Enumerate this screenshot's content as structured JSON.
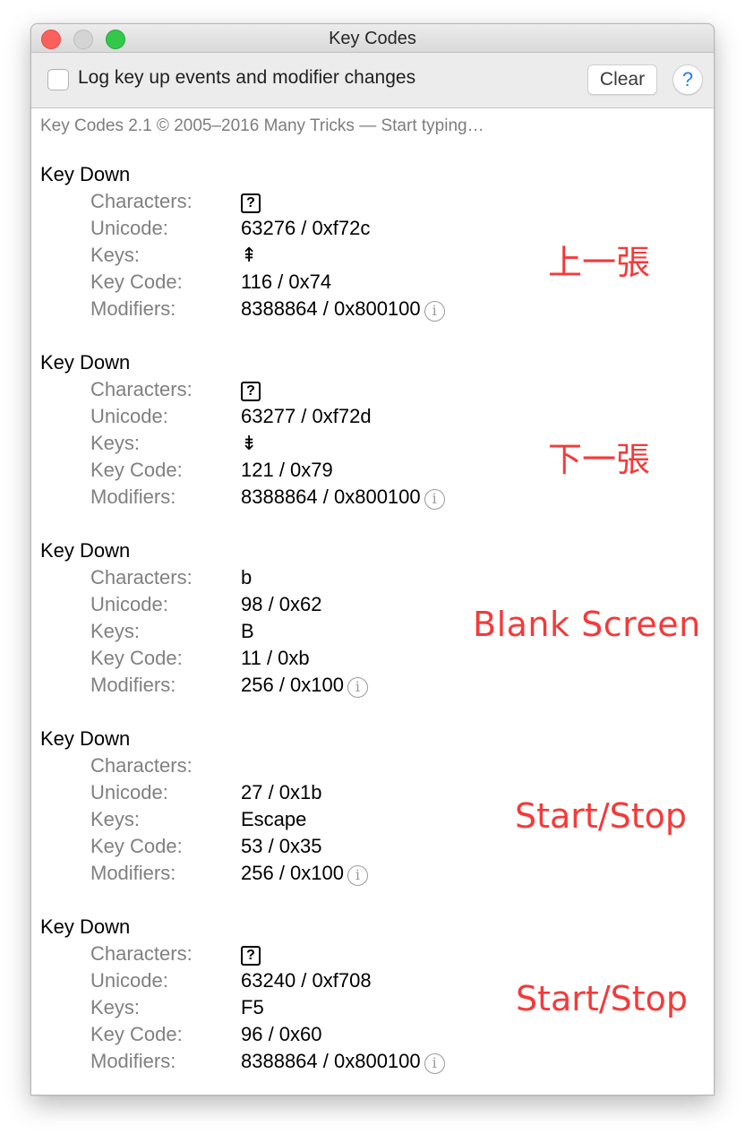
{
  "window": {
    "title": "Key Codes"
  },
  "toolbar": {
    "checkbox_label": "Log key up events and modifier changes",
    "checkbox_checked": false,
    "clear_label": "Clear",
    "help_label": "?"
  },
  "banner": "Key Codes 2.1 © 2005–2016 Many Tricks — Start typing…",
  "field_labels": {
    "characters": "Characters:",
    "unicode": "Unicode:",
    "keys": "Keys:",
    "key_code": "Key Code:",
    "modifiers": "Modifiers:"
  },
  "events": [
    {
      "title": "Key Down",
      "characters": "?",
      "characters_is_placeholder_box": true,
      "unicode": "63276 / 0xf72c",
      "keys": "⇞",
      "key_code": "116 / 0x74",
      "modifiers": "8388864 / 0x800100",
      "annotation": "上一張"
    },
    {
      "title": "Key Down",
      "characters": "?",
      "characters_is_placeholder_box": true,
      "unicode": "63277 / 0xf72d",
      "keys": "⇟",
      "key_code": "121 / 0x79",
      "modifiers": "8388864 / 0x800100",
      "annotation": "下一張"
    },
    {
      "title": "Key Down",
      "characters": "b",
      "characters_is_placeholder_box": false,
      "unicode": "98 / 0x62",
      "keys": "B",
      "key_code": "11 / 0xb",
      "modifiers": "256 / 0x100",
      "annotation": "Blank Screen"
    },
    {
      "title": "Key Down",
      "characters": "",
      "characters_is_placeholder_box": false,
      "unicode": "27 / 0x1b",
      "keys": "Escape",
      "key_code": "53 / 0x35",
      "modifiers": "256 / 0x100",
      "annotation": "Start/Stop"
    },
    {
      "title": "Key Down",
      "characters": "?",
      "characters_is_placeholder_box": true,
      "unicode": "63240 / 0xf708",
      "keys": "F5",
      "key_code": "96 / 0x60",
      "modifiers": "8388864 / 0x800100",
      "annotation": "Start/Stop"
    }
  ],
  "info_icon_glyph": "i",
  "colors": {
    "annotation": "#f43a3a",
    "label_gray": "#808080",
    "help_blue": "#1f7cf2"
  }
}
